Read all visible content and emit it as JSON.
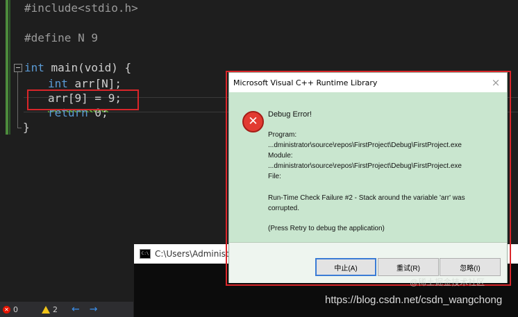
{
  "editor": {
    "lines": {
      "l1": "#include<stdio.h>",
      "l2": "#define N 9",
      "l3_kw": "int",
      "l3_rest": " main(void) {",
      "l4_kw": "int",
      "l4_rest": " arr[N];",
      "l5": "arr[9] = 9;",
      "l6_kw": "return",
      "l6_rest": " 0;",
      "l7": "}"
    }
  },
  "statusbar": {
    "errors": "0",
    "warnings": "2",
    "back_arrow": "←",
    "forward_arrow": "→"
  },
  "console": {
    "title": "C:\\Users\\Administra",
    "icon_text": "C:\\"
  },
  "dialog": {
    "title": "Microsoft Visual C++ Runtime Library",
    "close": "×",
    "error_glyph": "✕",
    "heading": "Debug Error!",
    "program_label": "Program:",
    "program_path": "...dministrator\\source\\repos\\FirstProject\\Debug\\FirstProject.exe",
    "module_label": "Module:",
    "module_path": "...dministrator\\source\\repos\\FirstProject\\Debug\\FirstProject.exe",
    "file_label": "File:",
    "message": "Run-Time Check Failure #2 - Stack around the variable 'arr' was\ncorrupted.",
    "hint": "(Press Retry to debug the application)",
    "buttons": {
      "abort": "中止(A)",
      "retry": "重试(R)",
      "ignore": "忽略(I)"
    }
  },
  "watermark": {
    "url": "https://blog.csdn.net/csdn_wangchong",
    "community": "@稀土掘金技术社区"
  },
  "colors": {
    "highlight_box": "#d9262a",
    "dialog_bg": "#c9e6cf",
    "keyword": "#5b9bd5"
  }
}
